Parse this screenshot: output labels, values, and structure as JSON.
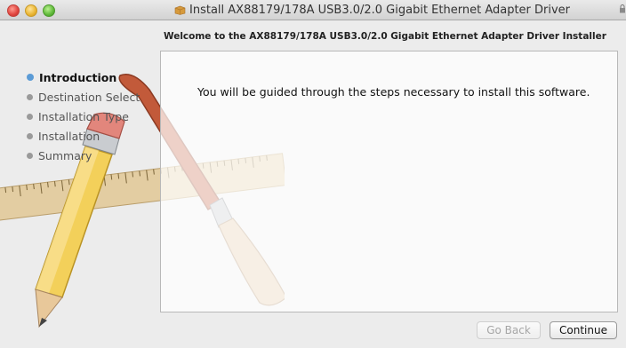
{
  "window": {
    "title": "Install AX88179/178A USB3.0/2.0 Gigabit Ethernet Adapter Driver",
    "title_icon": "package-icon"
  },
  "header": {
    "welcome": "Welcome to the AX88179/178A USB3.0/2.0 Gigabit Ethernet Adapter Driver Installer"
  },
  "sidebar": {
    "steps": [
      {
        "label": "Introduction",
        "active": true
      },
      {
        "label": "Destination Select",
        "active": false
      },
      {
        "label": "Installation Type",
        "active": false
      },
      {
        "label": "Installation",
        "active": false
      },
      {
        "label": "Summary",
        "active": false
      }
    ]
  },
  "main": {
    "text": "You will be guided through the steps necessary to install this software."
  },
  "buttons": {
    "back": "Go Back",
    "continue": "Continue"
  },
  "colors": {
    "active_step": "#5b9bd6",
    "window_bg": "#ececec"
  }
}
